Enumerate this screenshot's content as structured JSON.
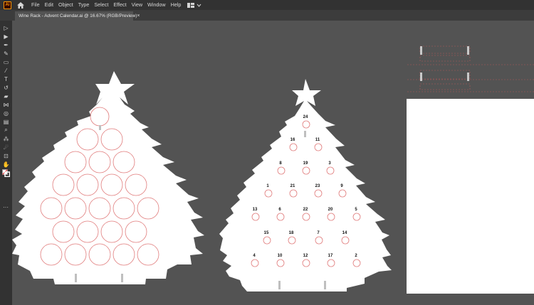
{
  "app": {
    "logo_text": "Ai"
  },
  "menu": [
    "File",
    "Edit",
    "Object",
    "Type",
    "Select",
    "Effect",
    "View",
    "Window",
    "Help"
  ],
  "document_tab": {
    "label": "Wine Rack - Advent Calendar.ai @ 16.67% (RGB/Preview)",
    "close": "×"
  },
  "tree_numbers": {
    "row1": [
      "24"
    ],
    "row2": [
      "16",
      "11"
    ],
    "row3": [
      "8",
      "19",
      "3"
    ],
    "row4": [
      "1",
      "21",
      "23",
      "9"
    ],
    "row5": [
      "13",
      "6",
      "22",
      "20",
      "5"
    ],
    "row6": [
      "15",
      "18",
      "7",
      "14"
    ],
    "row7": [
      "4",
      "10",
      "12",
      "17",
      "2"
    ]
  },
  "colors": {
    "canvas": "#535353",
    "chrome": "#323232",
    "cut_line": "#e07a7a",
    "accent": "#ff9a00"
  },
  "tools": [
    "selection-tool",
    "direct-selection-tool",
    "pen-tool",
    "curvature-tool",
    "rectangle-tool",
    "paintbrush-tool",
    "type-tool",
    "rotate-tool",
    "eraser-tool",
    "width-tool",
    "shape-builder-tool",
    "gradient-tool",
    "eyedropper-tool",
    "blend-tool",
    "symbol-sprayer-tool",
    "artboard-tool",
    "hand-tool",
    "zoom-tool"
  ]
}
